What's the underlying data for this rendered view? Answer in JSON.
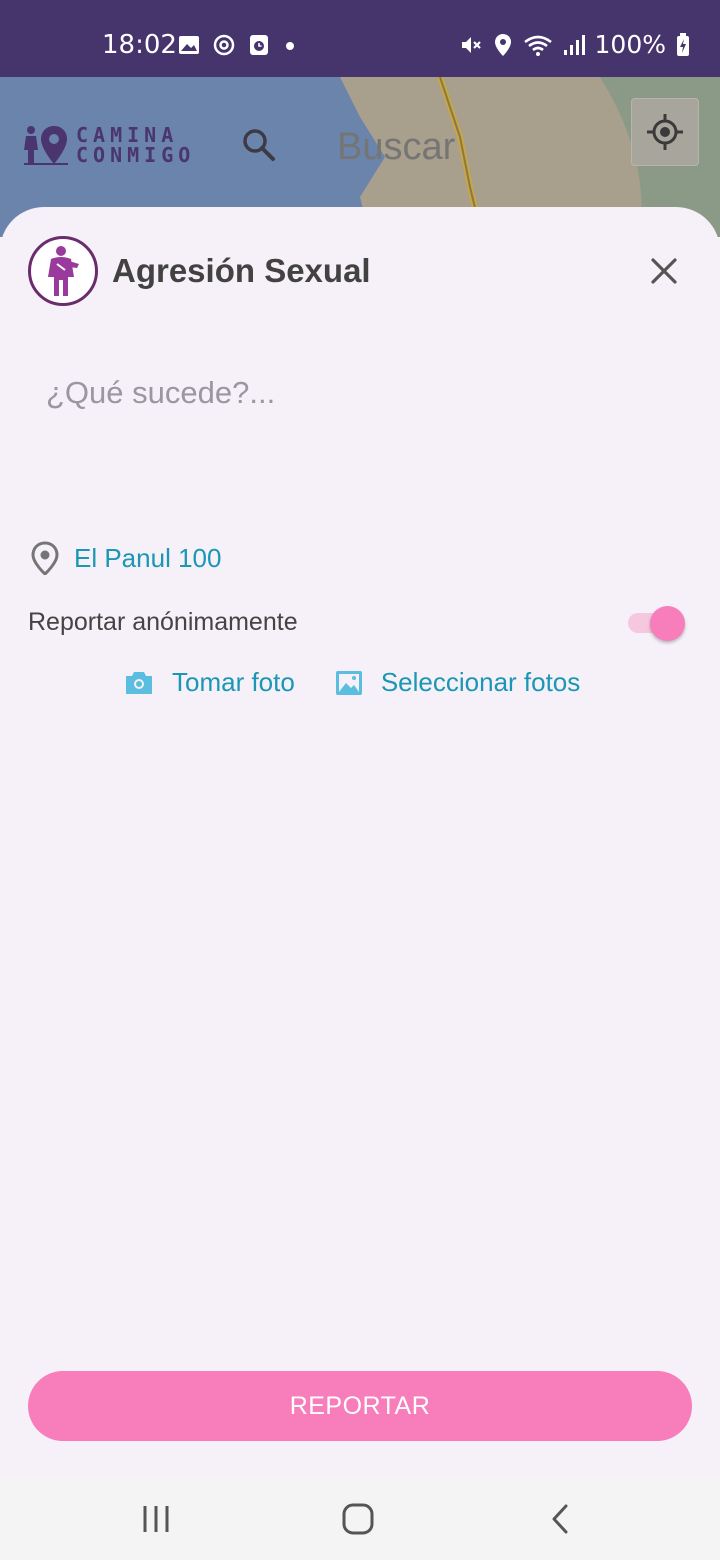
{
  "status_bar": {
    "time": "18:02",
    "battery": "100%",
    "left_icons": [
      "image-icon",
      "sync-icon",
      "clock-app-icon",
      "dot-icon"
    ],
    "right_icons": [
      "mute-icon",
      "location-icon",
      "wifi-icon",
      "signal-icon",
      "battery-charging-icon"
    ]
  },
  "header": {
    "brand_line1": "CAMINA",
    "brand_line2": "CONMIGO",
    "search_placeholder": "Buscar"
  },
  "sheet": {
    "title": "Agresión Sexual",
    "description_placeholder": "¿Qué sucede?...",
    "location": "El Panul 100",
    "anonymous_label": "Reportar anónimamente",
    "anonymous_enabled": true,
    "take_photo_label": "Tomar foto",
    "select_photos_label": "Seleccionar fotos",
    "report_button_label": "REPORTAR"
  },
  "colors": {
    "status_bar": "#46356d",
    "accent_pink": "#f77dbb",
    "link_blue": "#1a97b5",
    "brand_purple": "#4a3570",
    "sheet_bg": "#f6f0f8"
  }
}
